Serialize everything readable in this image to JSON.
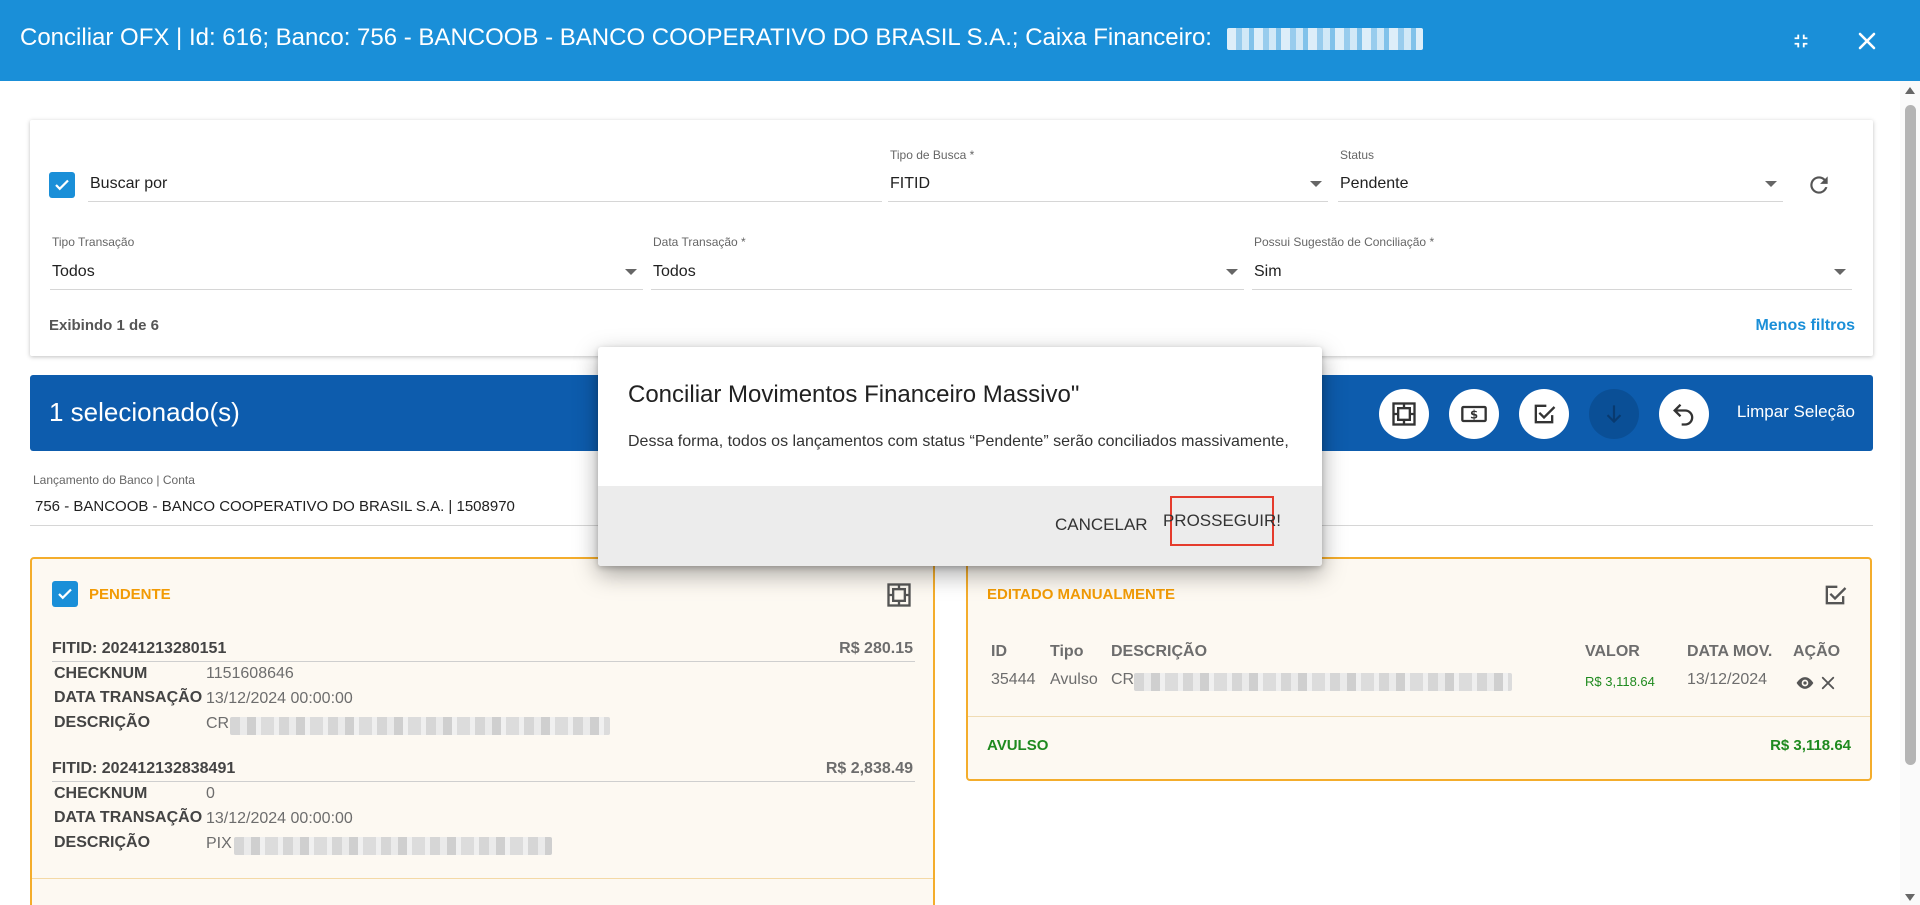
{
  "window": {
    "title": "Conciliar OFX | Id: 616; Banco: 756 - BANCOOB - BANCO COOPERATIVO DO BRASIL S.A.; Caixa Financeiro:",
    "minimize_icon": "collapse-arrows-icon",
    "close_icon": "close-icon"
  },
  "filters": {
    "buscar_por": {
      "placeholder": "Buscar por",
      "checked": true
    },
    "tipo_busca": {
      "label": "Tipo de Busca *",
      "value": "FITID"
    },
    "status": {
      "label": "Status",
      "value": "Pendente"
    },
    "refresh_icon": "refresh-icon",
    "tipo_transacao": {
      "label": "Tipo Transação",
      "value": "Todos"
    },
    "data_transacao": {
      "label": "Data Transação *",
      "value": "Todos"
    },
    "possui_sugestao": {
      "label": "Possui Sugestão de Conciliação *",
      "value": "Sim"
    },
    "exibindo": "Exibindo 1 de 6",
    "menos_filtros": "Menos filtros"
  },
  "selection_bar": {
    "count_label": "1 selecionado(s)",
    "actions": [
      {
        "icon": "conciliar-frame-icon",
        "enabled": true
      },
      {
        "icon": "money-icon",
        "enabled": true
      },
      {
        "icon": "check-box-icon",
        "enabled": true
      },
      {
        "icon": "arrow-down-icon",
        "enabled": false
      },
      {
        "icon": "undo-icon",
        "enabled": true
      }
    ],
    "clear_label": "Limpar Seleção"
  },
  "lancamento": {
    "label": "Lançamento do Banco | Conta",
    "value": "756 - BANCOOB - BANCO COOPERATIVO DO BRASIL S.A. | 1508970"
  },
  "left_panel": {
    "title": "PENDENTE",
    "checked": true,
    "entries": [
      {
        "fitid": "FITID: 20241213280151",
        "amount": "R$ 280.15",
        "checknum_label": "CHECKNUM",
        "checknum": "1151608646",
        "data_label": "DATA TRANSAÇÃO",
        "data": "13/12/2024 00:00:00",
        "desc_label": "DESCRIÇÃO",
        "desc_prefix": "CR"
      },
      {
        "fitid": "FITID: 202412132838491",
        "amount": "R$ 2,838.49",
        "checknum_label": "CHECKNUM",
        "checknum": "0",
        "data_label": "DATA TRANSAÇÃO",
        "data": "13/12/2024 00:00:00",
        "desc_label": "DESCRIÇÃO",
        "desc_prefix": "PIX"
      }
    ]
  },
  "right_panel": {
    "title": "EDITADO MANUALMENTE",
    "columns": [
      "ID",
      "Tipo",
      "DESCRIÇÃO",
      "VALOR",
      "DATA MOV.",
      "AÇÃO"
    ],
    "row": {
      "id": "35444",
      "tipo": "Avulso",
      "desc_prefix": "CR",
      "valor": "R$ 3,118.64",
      "data": "13/12/2024"
    },
    "footer_label": "AVULSO",
    "footer_value": "R$ 3,118.64"
  },
  "modal": {
    "title": "Conciliar Movimentos Financeiro Massivo\"",
    "text": "Dessa forma, todos os lançamentos com status “Pendente” serão conciliados massivamente,",
    "cancel_label": "CANCELAR",
    "proceed_label": "PROSSEGUIR!"
  },
  "colors": {
    "titlebar": "#1a8fd8",
    "selection_bar": "#0d5cad",
    "panel_border": "#f4ad2c",
    "pending_title": "#f29b05",
    "positive": "#1f8a1f",
    "highlight_box": "#e53b2c"
  }
}
